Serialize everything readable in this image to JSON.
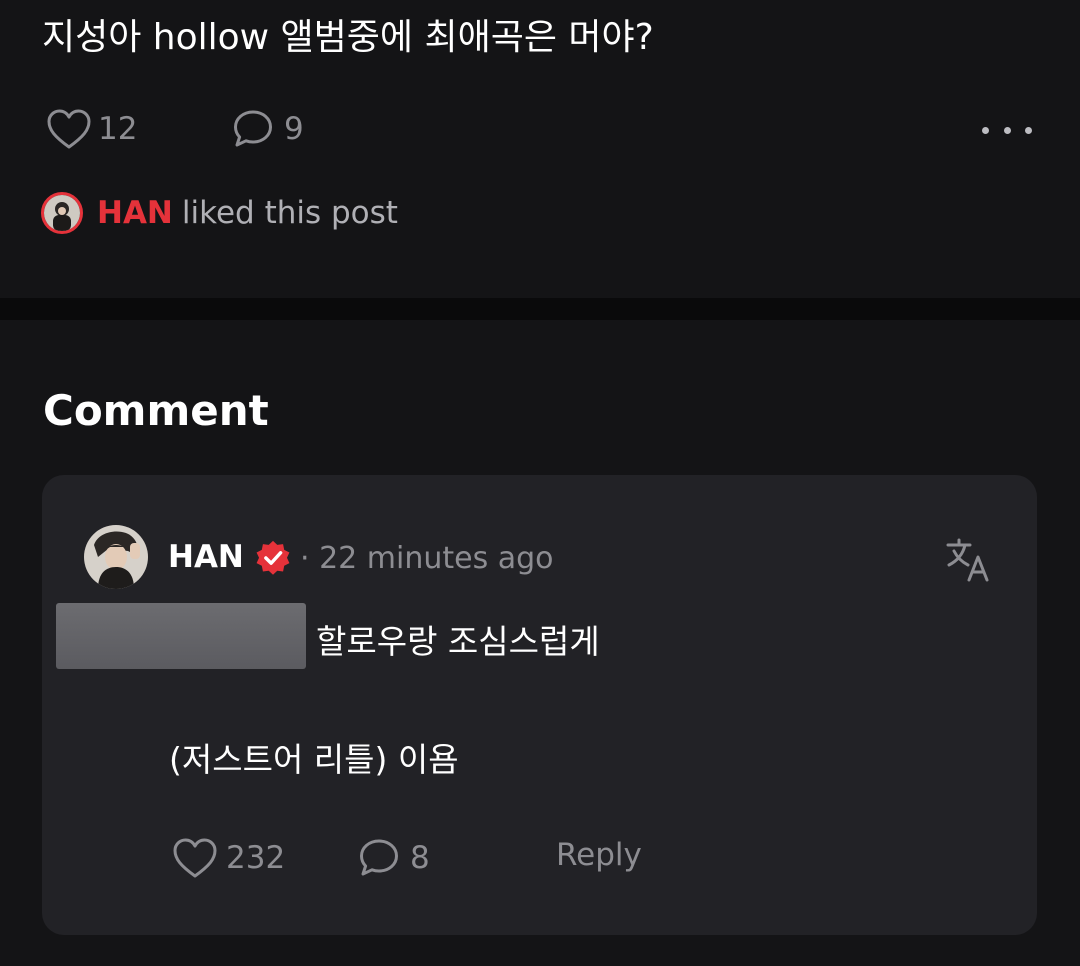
{
  "post": {
    "text": "지성아 hollow 앨범중에 최애곡은 머야?",
    "like_count": "12",
    "comment_count": "9",
    "liked_by": {
      "name": "HAN",
      "text": "liked this post"
    }
  },
  "comments_section": {
    "title": "Comment"
  },
  "comment": {
    "author": "HAN",
    "time": "· 22 minutes ago",
    "body_line1": "할로우랑 조심스럽게",
    "body_line2": "(저스트어 리틀) 이욤",
    "like_count": "232",
    "reply_count": "8",
    "reply_label": "Reply"
  },
  "icons": {
    "like": "heart-icon",
    "comment": "speech-bubble-icon",
    "more": "more-horizontal-icon",
    "verified": "verified-badge-icon",
    "translate": "translate-icon"
  },
  "colors": {
    "background": "#141416",
    "card": "#222226",
    "accent": "#e5323a",
    "muted_text": "#8d8d92"
  }
}
